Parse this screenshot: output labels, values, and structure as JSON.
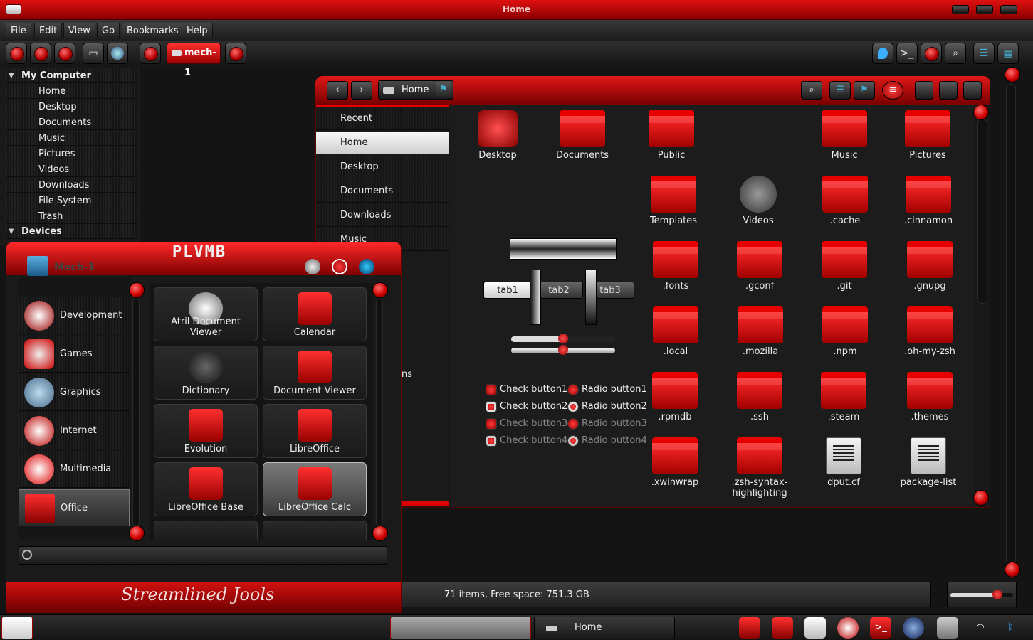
{
  "window": {
    "title": "Home"
  },
  "menubar": [
    "File",
    "Edit",
    "View",
    "Go",
    "Bookmarks",
    "Help"
  ],
  "toolbar": {
    "path_label": "mech-1"
  },
  "tree": {
    "computer_label": "My Computer",
    "items": [
      "Home",
      "Desktop",
      "Documents",
      "Music",
      "Pictures",
      "Videos",
      "Downloads",
      "File System",
      "Trash"
    ],
    "devices_label": "Devices"
  },
  "fm": {
    "location": "Home",
    "places": [
      "Recent",
      "Home",
      "Desktop",
      "Documents",
      "Downloads",
      "Music"
    ],
    "places_partial": "ns",
    "tabs": [
      "tab1",
      "tab2",
      "tab3"
    ],
    "checks": [
      "Check button1",
      "Check button2",
      "Check button3",
      "Check button4"
    ],
    "radios": [
      "Radio button1",
      "Radio button2",
      "Radio button3",
      "Radio button4"
    ],
    "files": [
      "Desktop",
      "Documents",
      "Public",
      "Music",
      "Pictures",
      "Templates",
      "Videos",
      ".cache",
      ".cinnamon",
      ".fonts",
      ".gconf",
      ".git",
      ".gnupg",
      ".local",
      ".mozilla",
      ".npm",
      ".oh-my-zsh",
      ".rpmdb",
      ".ssh",
      ".steam",
      ".themes",
      ".xwinwrap",
      ".zsh-syntax-highlighting",
      "dput.cf",
      "package-list"
    ],
    "status": "71 items, Free space: 751.3 GB",
    "zoom_level": 0.75
  },
  "menu": {
    "logo": "PLVMB",
    "user": "Mech-1",
    "categories": [
      "Development",
      "Games",
      "Graphics",
      "Internet",
      "Multimedia",
      "Office"
    ],
    "apps": [
      "Atril Document Viewer",
      "Calendar",
      "Dictionary",
      "Document Viewer",
      "Evolution",
      "LibreOffice",
      "LibreOffice Base",
      "LibreOffice Calc"
    ],
    "signature": "Streamlined Jools"
  },
  "taskbar": {
    "window_label": "Home"
  },
  "colors": {
    "accent": "#d40000",
    "dark": "#1a1a1a"
  }
}
